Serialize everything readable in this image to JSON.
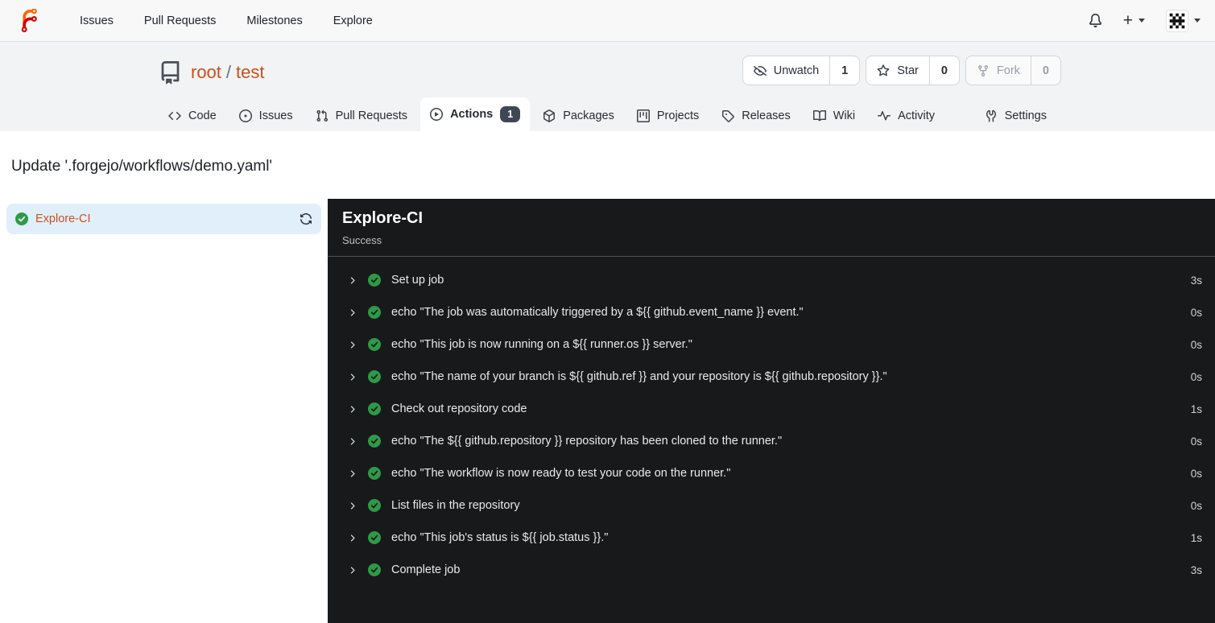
{
  "navbar": {
    "items": [
      "Issues",
      "Pull Requests",
      "Milestones",
      "Explore"
    ],
    "plus_label": "+",
    "icons": [
      "forgejo-logo",
      "bell-icon",
      "plus-icon",
      "avatar"
    ]
  },
  "repo_header": {
    "owner": "root",
    "separator": "/",
    "name": "test",
    "buttons": {
      "unwatch": {
        "label": "Unwatch",
        "count": "1"
      },
      "star": {
        "label": "Star",
        "count": "0"
      },
      "fork": {
        "label": "Fork",
        "count": "0",
        "disabled": true
      }
    }
  },
  "tabs": [
    {
      "label": "Code"
    },
    {
      "label": "Issues"
    },
    {
      "label": "Pull Requests"
    },
    {
      "label": "Actions",
      "badge": "1",
      "active": true
    },
    {
      "label": "Packages"
    },
    {
      "label": "Projects"
    },
    {
      "label": "Releases"
    },
    {
      "label": "Wiki"
    },
    {
      "label": "Activity"
    },
    {
      "label": "Settings"
    }
  ],
  "run": {
    "title": "Update '.forgejo/workflows/demo.yaml'",
    "sidebar_job": {
      "name": "Explore-CI",
      "status": "success"
    },
    "panel": {
      "title": "Explore-CI",
      "status": "Success",
      "steps": [
        {
          "name": "Set up job",
          "duration": "3s"
        },
        {
          "name": "echo \"The job was automatically triggered by a ${{ github.event_name }} event.\"",
          "duration": "0s"
        },
        {
          "name": "echo \"This job is now running on a ${{ runner.os }} server.\"",
          "duration": "0s"
        },
        {
          "name": "echo \"The name of your branch is ${{ github.ref }} and your repository is ${{ github.repository }}.\"",
          "duration": "0s"
        },
        {
          "name": "Check out repository code",
          "duration": "1s"
        },
        {
          "name": "echo \"The ${{ github.repository }} repository has been cloned to the runner.\"",
          "duration": "0s"
        },
        {
          "name": "echo \"The workflow is now ready to test your code on the runner.\"",
          "duration": "0s"
        },
        {
          "name": "List files in the repository",
          "duration": "0s"
        },
        {
          "name": "echo \"This job's status is ${{ job.status }}.\"",
          "duration": "1s"
        },
        {
          "name": "Complete job",
          "duration": "3s"
        }
      ]
    }
  },
  "colors": {
    "accent_link": "#c8501e",
    "success_green": "#2c9a47",
    "panel_bg": "#18191b",
    "badge_bg": "#3f4756",
    "selected_job_bg": "#e1effb",
    "logo_orange": "#ff6600",
    "logo_red": "#d40000"
  }
}
